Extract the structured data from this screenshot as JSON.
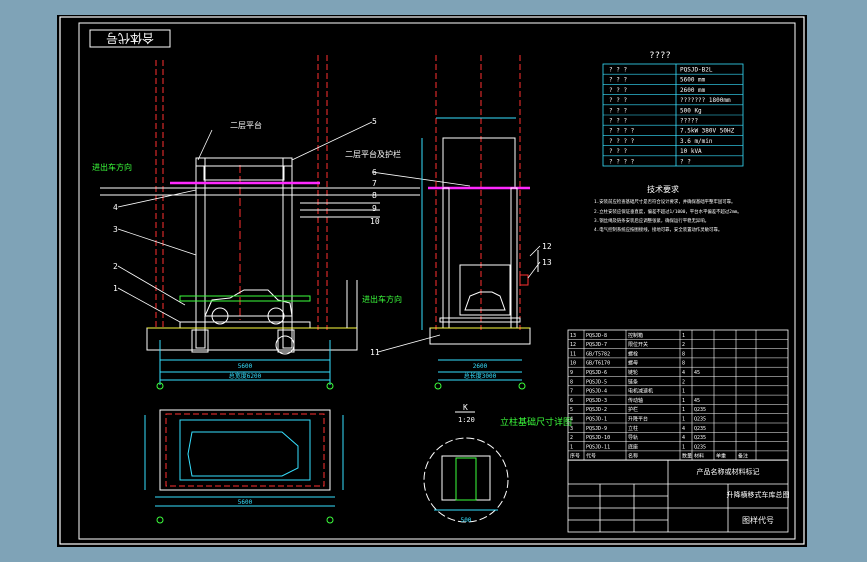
{
  "title_stamp": "合体代号",
  "note_top_left": "二层平台",
  "note_top_mid": "二层平台及护栏",
  "label_entry": "进出车方向",
  "label_exit": "进出车方向",
  "scale_label": "K",
  "scale_value": "1:20",
  "detail_title": "立柱基础尺寸详图",
  "table_title": "????",
  "specs": [
    {
      "label": "?    ?    ?",
      "value": "PQSJD-B2L"
    },
    {
      "label": "?  ?  ?",
      "value": "5600 mm"
    },
    {
      "label": "?  ?  ?",
      "value": "2600 mm"
    },
    {
      "label": "?  ?  ?",
      "value": "???????  1800mm"
    },
    {
      "label": "?  ?  ?",
      "value": "500 Kg"
    },
    {
      "label": "?  ?  ?",
      "value": "?????"
    },
    {
      "label": "?  ?  ?  ?",
      "value": "7.5kW  380V  50HZ"
    },
    {
      "label": "?  ?  ?  ?",
      "value": "3.6 m/min"
    },
    {
      "label": "?  ?  ?",
      "value": "10 kVA"
    },
    {
      "label": "?  ?  ?  ?",
      "value": "?  ?"
    }
  ],
  "tech_title": "技术要求",
  "tech_lines": [
    "1.安装前应检查基础尺寸是否符合设计要求，并确保基础平整牢固可靠。",
    "2.立柱安装应保证垂直度，偏差不超过1/1000，平台水平偏差不超过2mm。",
    "3.钢丝绳及链条安装后应调整张紧，确保运行平稳无异响。",
    "4.电气控制系统应按图接线，接地可靠，安全装置动作灵敏可靠。"
  ],
  "callouts_left": [
    "1",
    "2",
    "3",
    "4"
  ],
  "callouts_right": [
    "5",
    "6",
    "7",
    "8",
    "9",
    "10"
  ],
  "callouts_far": [
    "11",
    "12",
    "13"
  ],
  "bom_rows": [
    [
      "13",
      "PQSJD-8",
      "控制箱",
      "1",
      "",
      "",
      ""
    ],
    [
      "12",
      "PQSJD-7",
      "限位开关",
      "2",
      "",
      "",
      ""
    ],
    [
      "11",
      "GB/T5782",
      "螺栓",
      "8",
      "",
      "",
      ""
    ],
    [
      "10",
      "GB/T6170",
      "螺母",
      "8",
      "",
      "",
      ""
    ],
    [
      "9",
      "PQSJD-6",
      "链轮",
      "4",
      "45",
      "",
      ""
    ],
    [
      "8",
      "PQSJD-5",
      "链条",
      "2",
      "",
      "",
      ""
    ],
    [
      "7",
      "PQSJD-4",
      "电机减速机",
      "1",
      "",
      "",
      ""
    ],
    [
      "6",
      "PQSJD-3",
      "传动轴",
      "1",
      "45",
      "",
      ""
    ],
    [
      "5",
      "PQSJD-2",
      "护栏",
      "1",
      "Q235",
      "",
      ""
    ],
    [
      "4",
      "PQSJD-1",
      "升降平台",
      "1",
      "Q235",
      "",
      ""
    ],
    [
      "3",
      "PQSJD-9",
      "立柱",
      "4",
      "Q235",
      "",
      ""
    ],
    [
      "2",
      "PQSJD-10",
      "导轨",
      "4",
      "Q235",
      "",
      ""
    ],
    [
      "1",
      "PQSJD-11",
      "底座",
      "1",
      "Q235",
      "",
      ""
    ]
  ],
  "bom_header": [
    "序号",
    "代号",
    "名称",
    "数量",
    "材料",
    "单重",
    "备注"
  ],
  "title_block_name": "升降横移式车库总图",
  "title_block_code": "图样代号",
  "title_block_org": "产品名称或材料标记",
  "dims": {
    "left_width": "5600",
    "left_total": "总宽度6200",
    "right_width": "2600",
    "right_total": "总长度3000",
    "plan_width": "5600",
    "detail_width": "500"
  },
  "colors": {
    "background": "#7fa3b7",
    "sheet": "#000000",
    "line_main": "#ffffff",
    "line_cyan": "#36e0ff",
    "line_green": "#3cff3c",
    "line_magenta": "#ff29ff",
    "line_red": "#ff3030",
    "line_yellow": "#ffff40"
  }
}
